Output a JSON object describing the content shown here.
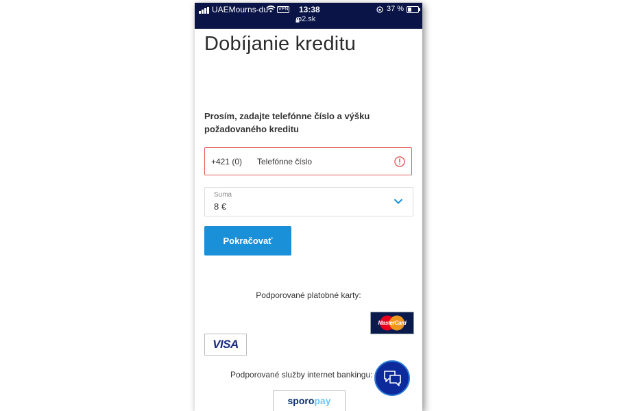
{
  "status_bar": {
    "carrier": "UAEMourns-du",
    "vpn": "VPN",
    "time": "13:38",
    "url": "o2.sk",
    "battery": "37 %"
  },
  "page": {
    "title": "Dobíjanie kreditu",
    "instruction": "Prosím, zadajte telefónne číslo a výšku požadovaného kreditu"
  },
  "phone_field": {
    "prefix": "+421 (0)",
    "placeholder": "Telefónne číslo",
    "error_icon": "exclamation-circle-icon"
  },
  "amount_field": {
    "label": "Suma",
    "value": "8 €",
    "icon": "chevron-down-icon"
  },
  "actions": {
    "continue_label": "Pokračovať"
  },
  "payment": {
    "cards_label": "Podporované platobné karty:",
    "mastercard": "MasterCard",
    "visa": "VISA",
    "banking_label": "Podporované služby internet bankingu:",
    "sporopay_a": "sporo",
    "sporopay_b": "pay"
  },
  "chat": {
    "icon": "chat-bubbles-icon"
  },
  "colors": {
    "status_bar_bg": "#0a1446",
    "primary_button": "#1a90d8",
    "error": "#e15a5a",
    "chevron": "#1a90d8",
    "chat_button": "#0c2a9c"
  }
}
